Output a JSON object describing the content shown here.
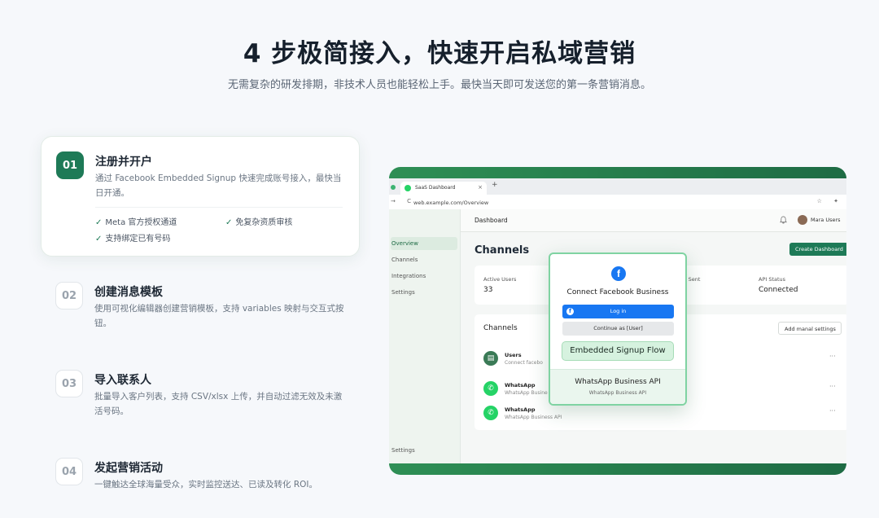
{
  "hero": {
    "title": "4 步极简接入，快速开启私域营销",
    "subtitle": "无需复杂的研发排期，非技术人员也能轻松上手。最快当天即可发送您的第一条营销消息。"
  },
  "steps": [
    {
      "number": "01",
      "title": "注册并开户",
      "description": "通过 Facebook Embedded Signup 快速完成账号接入，最快当日开通。",
      "features": [
        "Meta 官方授权通道",
        "免复杂资质审核",
        "支持绑定已有号码"
      ],
      "active": true
    },
    {
      "number": "02",
      "title": "创建消息模板",
      "description": "使用可视化编辑器创建营销模板，支持 variables 映射与交互式按钮。"
    },
    {
      "number": "03",
      "title": "导入联系人",
      "description": "批量导入客户列表，支持 CSV/xlsx 上传，并自动过滤无效及未激活号码。"
    },
    {
      "number": "04",
      "title": "发起营销活动",
      "description": "一键触达全球海量受众，实时监控送达、已读及转化 ROI。"
    }
  ],
  "check_glyph": "✓",
  "browser": {
    "tab_title": "SaaS Dashboard",
    "url": "web.example.com/Overview",
    "nav_glyphs": "→ C",
    "ext_glyphs": "☆ ✦"
  },
  "dashboard": {
    "header_title": "Dashboard",
    "user_name": "Mara Users",
    "sidebar": [
      "Overview",
      "Channels",
      "Integrations",
      "Settings"
    ],
    "sidebar_bottom": "Settings",
    "page_title": "Channels",
    "create_button": "Create Dashboard",
    "stats": [
      {
        "label": "Active Users",
        "value": "33"
      },
      {
        "label": "ges Sent",
        "value": ""
      },
      {
        "label": "API Status",
        "value": "Connected"
      }
    ],
    "channels_title": "Channels",
    "manage_button": "Add manal settings",
    "rows": [
      {
        "name": "Users",
        "sub": "Connect facebo",
        "icon": "users-icon"
      },
      {
        "name": "WhatsApp",
        "sub": "WhatsApp Busine",
        "icon": "whatsapp-icon"
      },
      {
        "name": "WhatsApp",
        "sub": "WhatsApp Business API",
        "icon": "whatsapp-icon"
      }
    ],
    "more_glyph": "···"
  },
  "modal": {
    "title": "Connect Facebook Business",
    "login_button": "Log in",
    "continue_button": "Continue as [User]",
    "embedded_label": "Embedded Signup Flow",
    "footer_title": "WhatsApp Business API",
    "footer_sub": "WhatsApp Business API"
  },
  "colors": {
    "accent": "#1e7a57",
    "facebook": "#1877f2",
    "whatsapp": "#25d366"
  }
}
